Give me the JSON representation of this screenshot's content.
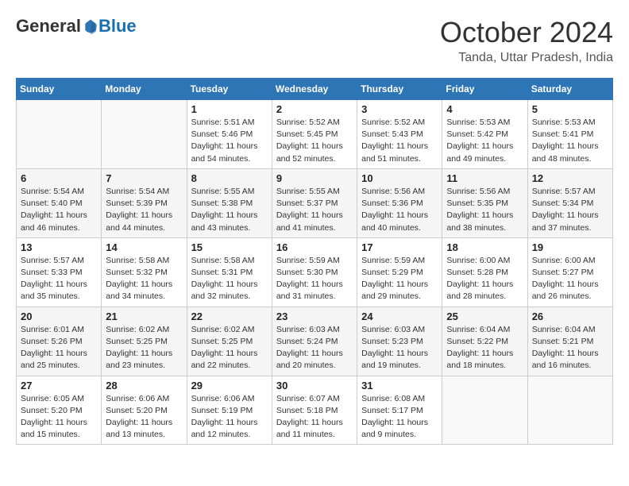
{
  "logo": {
    "general": "General",
    "blue": "Blue"
  },
  "title": "October 2024",
  "location": "Tanda, Uttar Pradesh, India",
  "days_of_week": [
    "Sunday",
    "Monday",
    "Tuesday",
    "Wednesday",
    "Thursday",
    "Friday",
    "Saturday"
  ],
  "weeks": [
    [
      {
        "day": "",
        "info": ""
      },
      {
        "day": "",
        "info": ""
      },
      {
        "day": "1",
        "info": "Sunrise: 5:51 AM\nSunset: 5:46 PM\nDaylight: 11 hours and 54 minutes."
      },
      {
        "day": "2",
        "info": "Sunrise: 5:52 AM\nSunset: 5:45 PM\nDaylight: 11 hours and 52 minutes."
      },
      {
        "day": "3",
        "info": "Sunrise: 5:52 AM\nSunset: 5:43 PM\nDaylight: 11 hours and 51 minutes."
      },
      {
        "day": "4",
        "info": "Sunrise: 5:53 AM\nSunset: 5:42 PM\nDaylight: 11 hours and 49 minutes."
      },
      {
        "day": "5",
        "info": "Sunrise: 5:53 AM\nSunset: 5:41 PM\nDaylight: 11 hours and 48 minutes."
      }
    ],
    [
      {
        "day": "6",
        "info": "Sunrise: 5:54 AM\nSunset: 5:40 PM\nDaylight: 11 hours and 46 minutes."
      },
      {
        "day": "7",
        "info": "Sunrise: 5:54 AM\nSunset: 5:39 PM\nDaylight: 11 hours and 44 minutes."
      },
      {
        "day": "8",
        "info": "Sunrise: 5:55 AM\nSunset: 5:38 PM\nDaylight: 11 hours and 43 minutes."
      },
      {
        "day": "9",
        "info": "Sunrise: 5:55 AM\nSunset: 5:37 PM\nDaylight: 11 hours and 41 minutes."
      },
      {
        "day": "10",
        "info": "Sunrise: 5:56 AM\nSunset: 5:36 PM\nDaylight: 11 hours and 40 minutes."
      },
      {
        "day": "11",
        "info": "Sunrise: 5:56 AM\nSunset: 5:35 PM\nDaylight: 11 hours and 38 minutes."
      },
      {
        "day": "12",
        "info": "Sunrise: 5:57 AM\nSunset: 5:34 PM\nDaylight: 11 hours and 37 minutes."
      }
    ],
    [
      {
        "day": "13",
        "info": "Sunrise: 5:57 AM\nSunset: 5:33 PM\nDaylight: 11 hours and 35 minutes."
      },
      {
        "day": "14",
        "info": "Sunrise: 5:58 AM\nSunset: 5:32 PM\nDaylight: 11 hours and 34 minutes."
      },
      {
        "day": "15",
        "info": "Sunrise: 5:58 AM\nSunset: 5:31 PM\nDaylight: 11 hours and 32 minutes."
      },
      {
        "day": "16",
        "info": "Sunrise: 5:59 AM\nSunset: 5:30 PM\nDaylight: 11 hours and 31 minutes."
      },
      {
        "day": "17",
        "info": "Sunrise: 5:59 AM\nSunset: 5:29 PM\nDaylight: 11 hours and 29 minutes."
      },
      {
        "day": "18",
        "info": "Sunrise: 6:00 AM\nSunset: 5:28 PM\nDaylight: 11 hours and 28 minutes."
      },
      {
        "day": "19",
        "info": "Sunrise: 6:00 AM\nSunset: 5:27 PM\nDaylight: 11 hours and 26 minutes."
      }
    ],
    [
      {
        "day": "20",
        "info": "Sunrise: 6:01 AM\nSunset: 5:26 PM\nDaylight: 11 hours and 25 minutes."
      },
      {
        "day": "21",
        "info": "Sunrise: 6:02 AM\nSunset: 5:25 PM\nDaylight: 11 hours and 23 minutes."
      },
      {
        "day": "22",
        "info": "Sunrise: 6:02 AM\nSunset: 5:25 PM\nDaylight: 11 hours and 22 minutes."
      },
      {
        "day": "23",
        "info": "Sunrise: 6:03 AM\nSunset: 5:24 PM\nDaylight: 11 hours and 20 minutes."
      },
      {
        "day": "24",
        "info": "Sunrise: 6:03 AM\nSunset: 5:23 PM\nDaylight: 11 hours and 19 minutes."
      },
      {
        "day": "25",
        "info": "Sunrise: 6:04 AM\nSunset: 5:22 PM\nDaylight: 11 hours and 18 minutes."
      },
      {
        "day": "26",
        "info": "Sunrise: 6:04 AM\nSunset: 5:21 PM\nDaylight: 11 hours and 16 minutes."
      }
    ],
    [
      {
        "day": "27",
        "info": "Sunrise: 6:05 AM\nSunset: 5:20 PM\nDaylight: 11 hours and 15 minutes."
      },
      {
        "day": "28",
        "info": "Sunrise: 6:06 AM\nSunset: 5:20 PM\nDaylight: 11 hours and 13 minutes."
      },
      {
        "day": "29",
        "info": "Sunrise: 6:06 AM\nSunset: 5:19 PM\nDaylight: 11 hours and 12 minutes."
      },
      {
        "day": "30",
        "info": "Sunrise: 6:07 AM\nSunset: 5:18 PM\nDaylight: 11 hours and 11 minutes."
      },
      {
        "day": "31",
        "info": "Sunrise: 6:08 AM\nSunset: 5:17 PM\nDaylight: 11 hours and 9 minutes."
      },
      {
        "day": "",
        "info": ""
      },
      {
        "day": "",
        "info": ""
      }
    ]
  ]
}
